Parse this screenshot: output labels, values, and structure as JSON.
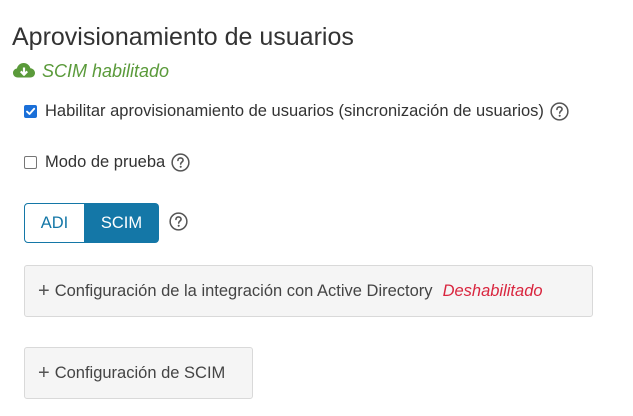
{
  "header": {
    "title": "Aprovisionamiento de usuarios",
    "status": {
      "icon": "cloud-download-icon",
      "text": "SCIM habilitado",
      "color": "#5a9a3a"
    }
  },
  "options": {
    "enable_provisioning": {
      "label": "Habilitar aprovisionamiento de usuarios (sincronización de usuarios)",
      "checked": true
    },
    "test_mode": {
      "label": "Modo de prueba",
      "checked": false
    }
  },
  "mode_toggle": {
    "options": [
      "ADI",
      "SCIM"
    ],
    "selected": "SCIM",
    "accent": "#1477a7"
  },
  "panels": {
    "ad_integration": {
      "label": "Configuración de la integración con Active Directory",
      "status": "Deshabilitado",
      "status_color": "#d9263f"
    },
    "scim_config": {
      "label": "Configuración de SCIM"
    }
  }
}
